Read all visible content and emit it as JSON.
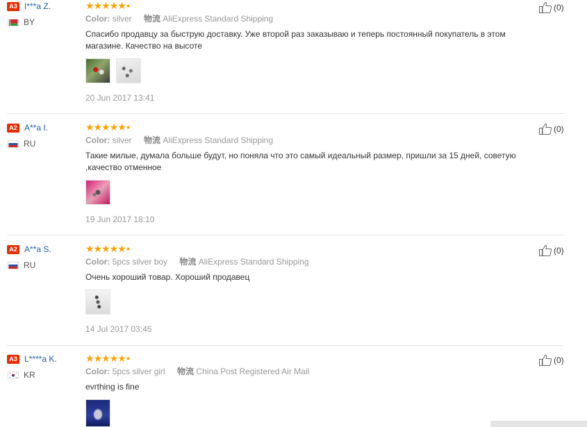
{
  "reviews": [
    {
      "level": "A3",
      "user": "I***a Z.",
      "country": "BY",
      "color_label": "Color:",
      "color_value": "silver",
      "shipping_label": "物流",
      "shipping_value": "AliExpress Standard Shipping",
      "text": "Спасибо продавцу за быструю доставку. Уже второй раз заказываю и теперь постоянный покупатель в этом магазине. Качество на высоте",
      "date": "20 Jun 2017 13:41",
      "likes": "(0)",
      "rating": 5,
      "photos": 2
    },
    {
      "level": "A2",
      "user": "A**a I.",
      "country": "RU",
      "color_label": "Color:",
      "color_value": "silver",
      "shipping_label": "物流",
      "shipping_value": "AliExpress Standard Shipping",
      "text": "Такие милые, думала больше будут, но поняла что это самый идеальный размер, пришли за 15 дней, советую ,качество отменное",
      "date": "19 Jun 2017 18:10",
      "likes": "(0)",
      "rating": 5,
      "photos": 1
    },
    {
      "level": "A2",
      "user": "A**a S.",
      "country": "RU",
      "color_label": "Color:",
      "color_value": "5pcs silver boy",
      "shipping_label": "物流",
      "shipping_value": "AliExpress Standard Shipping",
      "text": "Очень хороший товар. Хороший продавец",
      "date": "14 Jul 2017 03:45",
      "likes": "(0)",
      "rating": 5,
      "photos": 1
    },
    {
      "level": "A3",
      "user": "L****a K.",
      "country": "KR",
      "color_label": "Color:",
      "color_value": "5pcs silver girl",
      "shipping_label": "物流",
      "shipping_value": "China Post Registered Air Mail",
      "text": "evrthing is fine",
      "date": "",
      "likes": "(0)",
      "rating": 5,
      "photos": 1
    }
  ],
  "icons": {
    "star": "star-icon",
    "like": "thumbs-up-icon"
  },
  "colors": {
    "level_badge": "#e62e04",
    "username": "#1f5ea8",
    "star": "#f7a400"
  }
}
